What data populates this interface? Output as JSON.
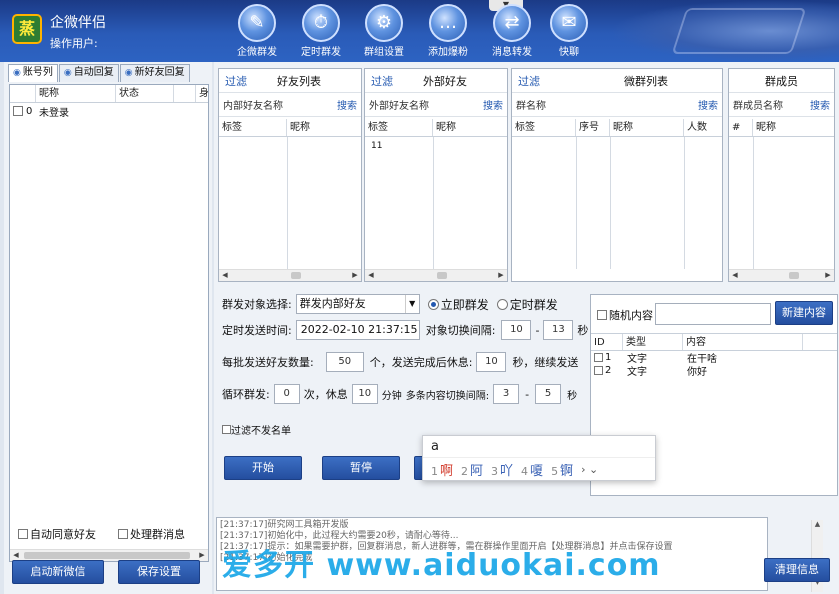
{
  "app": {
    "title": "企微伴侣",
    "user_label": "操作用户:"
  },
  "toolbar": [
    {
      "label": "企微群发",
      "icon": "pen-icon",
      "glyph": "✎"
    },
    {
      "label": "定时群发",
      "icon": "timer-icon",
      "glyph": "⏱"
    },
    {
      "label": "群组设置",
      "icon": "gear-icon",
      "glyph": "⚙"
    },
    {
      "label": "添加爆粉",
      "icon": "chat-dots-icon",
      "glyph": "…"
    },
    {
      "label": "消息转发",
      "icon": "forward-icon",
      "glyph": "⇄"
    },
    {
      "label": "快聊",
      "icon": "quick-chat-icon",
      "glyph": "✉"
    }
  ],
  "left": {
    "tabs": [
      "账号列",
      "自动回复",
      "新好友回复"
    ],
    "columns": [
      "昵称",
      "状态",
      "",
      "身"
    ],
    "rows": [
      {
        "index": "0",
        "name": "未登录",
        "checked": false
      }
    ],
    "auto_agree": "自动同意好友",
    "handle_group": "处理群消息",
    "start_wechat": "启动新微信",
    "save_settings": "保存设置"
  },
  "panels": {
    "friends": {
      "filter": "过滤",
      "title": "好友列表",
      "sub": "内部好友名称",
      "search": "搜索",
      "cols": [
        "标签",
        "昵称"
      ],
      "rows": []
    },
    "external": {
      "filter": "过滤",
      "title": "外部好友",
      "sub": "外部好友名称",
      "search": "搜索",
      "cols": [
        "标签",
        "昵称"
      ],
      "rows": [
        [
          "11",
          ""
        ]
      ]
    },
    "groups": {
      "filter": "过滤",
      "title": "微群列表",
      "sub": "群名称",
      "search": "搜索",
      "cols": [
        "标签",
        "序号",
        "昵称",
        "人数"
      ]
    },
    "members": {
      "title": "群成员",
      "sub": "群成员名称",
      "search": "搜索",
      "cols": [
        "#",
        "昵称"
      ]
    }
  },
  "form": {
    "target_label": "群发对象选择:",
    "target_value": "群发内部好友",
    "send_now": "立即群发",
    "timed_send": "定时群发",
    "time_label": "定时发送时间:",
    "time_value": "2022-02-10 21:37:15",
    "switch_label": "对象切换间隔:",
    "switch_min": "10",
    "switch_max": "13",
    "sec": "秒",
    "batch_label": "每批发送好友数量:",
    "batch_value": "50",
    "batch_mid": "个，发送完成后休息:",
    "rest_value": "10",
    "batch_end": "秒，继续发送",
    "loop_label": "循环群发:",
    "loop_value": "0",
    "loop_mid": "次，休息",
    "loop_rest": "10",
    "minutes": "分钟",
    "content_switch": "多条内容切换间隔:",
    "cs_min": "3",
    "cs_max": "5",
    "filter_unsent": "过滤不发名单",
    "start": "开始",
    "pause": "暂停"
  },
  "content": {
    "random": "随机内容",
    "new": "新建内容",
    "cols": [
      "ID",
      "类型",
      "内容"
    ],
    "rows": [
      {
        "id": "1",
        "type": "文字",
        "text": "在干啥"
      },
      {
        "id": "2",
        "type": "文字",
        "text": "你好"
      }
    ]
  },
  "ime": {
    "input": "a",
    "candidates": [
      {
        "n": "1",
        "c": "啊"
      },
      {
        "n": "2",
        "c": "阿"
      },
      {
        "n": "3",
        "c": "吖"
      },
      {
        "n": "4",
        "c": "嗄"
      },
      {
        "n": "5",
        "c": "锕"
      }
    ],
    "more": "› ⌄"
  },
  "log": {
    "lines": [
      "[21:37:17]研究网工具箱开发版",
      "[21:37:17]初始化中，此过程大约需要20秒，请耐心等待...",
      "[21:37:17]提示：如果需要护群，回复群消息，新人进群等，需在群操作里面开启【处理群消息】并点击保存设置",
      "[21:37:17]初始化完成"
    ],
    "clear": "清理信息"
  },
  "watermark": "爱多开 www.aiduokai.com"
}
